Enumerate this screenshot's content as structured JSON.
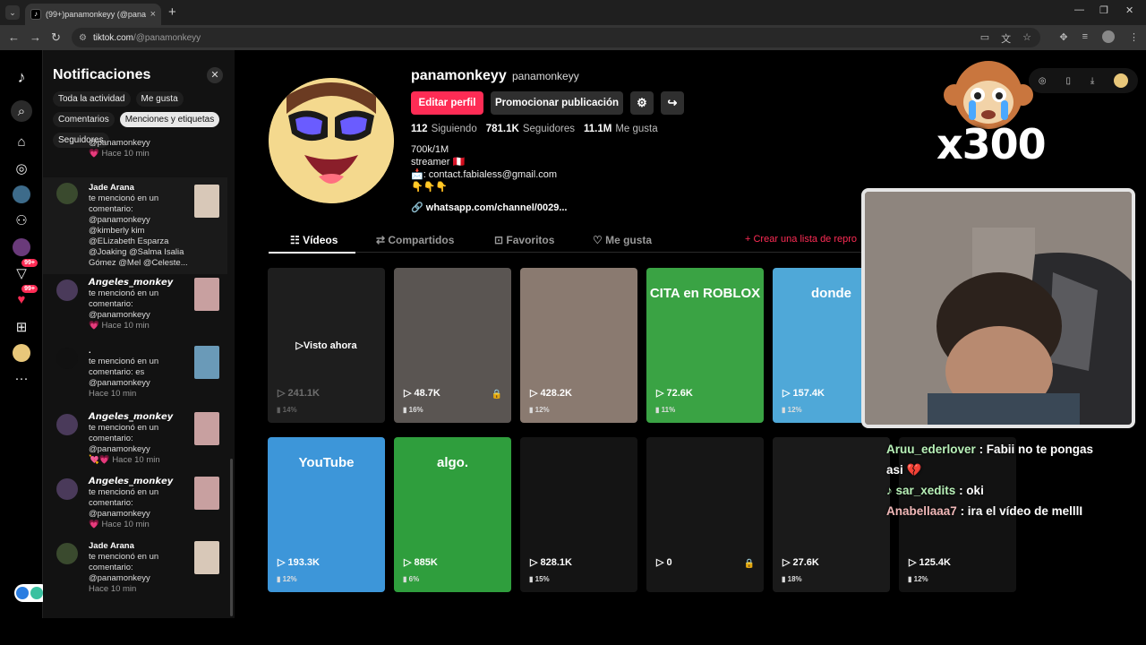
{
  "browser": {
    "tab_title": "(99+)panamonkeyy (@panamo…",
    "url_host": "tiktok.com",
    "url_path": "/@panamonkeyy"
  },
  "rail": {
    "badge_1": "99+",
    "badge_2": "99+"
  },
  "notifications": {
    "title": "Notificaciones",
    "filters": [
      {
        "label": "Toda la actividad",
        "active": false
      },
      {
        "label": "Me gusta",
        "active": false
      },
      {
        "label": "Comentarios",
        "active": false
      },
      {
        "label": "Menciones y etiquetas",
        "active": true
      },
      {
        "label": "Seguidores",
        "active": false
      }
    ],
    "items": [
      {
        "name": "",
        "lines": [
          "@panamonkeyy"
        ],
        "heart": "💗",
        "time": "Hace 10 min"
      },
      {
        "name": "Jade Arana",
        "lines": [
          "te mencionó en un",
          "comentario:",
          "@panamonkeyy",
          "@kimberly kim",
          "@ELizabeth Esparza",
          "@Joaking @Salma Isalia",
          "Gómez @Mel @Celeste..."
        ],
        "heart": "",
        "time": ""
      },
      {
        "name": "𝘼𝙣𝙜𝙚𝙡𝙚𝙨_𝙢𝙤𝙣𝙠𝙚𝙮",
        "lines": [
          "te mencionó en un",
          "comentario:",
          "@panamonkeyy"
        ],
        "heart": "💗",
        "time": "Hace 10 min"
      },
      {
        "name": ".",
        "lines": [
          "te mencionó en un",
          "comentario: es",
          "@panamonkeyy"
        ],
        "heart": "",
        "time": "Hace 10 min"
      },
      {
        "name": "𝘼𝙣𝙜𝙚𝙡𝙚𝙨_𝙢𝙤𝙣𝙠𝙚𝙮",
        "lines": [
          "te mencionó en un",
          "comentario:",
          "@panamonkeyy"
        ],
        "heart": "💘💗",
        "time": "Hace 10 min"
      },
      {
        "name": "𝘼𝙣𝙜𝙚𝙡𝙚𝙨_𝙢𝙤𝙣𝙠𝙚𝙮",
        "lines": [
          "te mencionó en un",
          "comentario:",
          "@panamonkeyy"
        ],
        "heart": "💗",
        "time": "Hace 10 min"
      },
      {
        "name": "Jade Arana",
        "lines": [
          "te mencionó en un",
          "comentario:",
          "@panamonkeyy"
        ],
        "heart": "",
        "time": "Hace 10 min"
      }
    ]
  },
  "profile": {
    "username": "panamonkeyy",
    "nickname": "panamonkeyy",
    "edit_button": "Editar perfil",
    "promote_button": "Promocionar publicación",
    "stats": [
      {
        "num": "112",
        "label": "Siguiendo"
      },
      {
        "num": "781.1K",
        "label": "Seguidores"
      },
      {
        "num": "11.1M",
        "label": "Me gusta"
      }
    ],
    "bio_lines": [
      "700k/1M",
      "streamer 🇵🇪",
      "📩: contact.fabialess@gmail.com",
      "👇👇👇"
    ],
    "link": "whatsapp.com/channel/0029...",
    "tabs": [
      "Vídeos",
      "Compartidos",
      "Favoritos",
      "Me gusta"
    ],
    "create_list": "+ Crear una lista de repro",
    "videos": [
      {
        "views": "241.1K",
        "pct": "14%",
        "overlay": "Visto ahora",
        "caption": "",
        "bg": "#1e1e1e",
        "lock": false
      },
      {
        "views": "48.7K",
        "pct": "16%",
        "overlay": "",
        "caption": "",
        "bg": "#5a5552",
        "lock": true
      },
      {
        "views": "428.2K",
        "pct": "12%",
        "overlay": "",
        "caption": "",
        "bg": "#8a7a70",
        "lock": false
      },
      {
        "views": "72.6K",
        "pct": "11%",
        "overlay": "",
        "caption": "CITA en ROBLOX",
        "bg": "#3aa344",
        "lock": false
      },
      {
        "views": "157.4K",
        "pct": "12%",
        "overlay": "",
        "caption": "donde",
        "bg": "#4fa8d8",
        "lock": false
      },
      {
        "views": "193.3K",
        "pct": "12%",
        "overlay": "",
        "caption": "YouTube",
        "bg": "#3d96d9",
        "lock": false
      },
      {
        "views": "885K",
        "pct": "6%",
        "overlay": "",
        "caption": "algo.",
        "bg": "#2f9e3d",
        "lock": false
      },
      {
        "views": "828.1K",
        "pct": "15%",
        "overlay": "",
        "caption": "",
        "bg": "#141414",
        "lock": false
      },
      {
        "views": "0",
        "pct": "",
        "overlay": "",
        "caption": "",
        "bg": "#161616",
        "lock": true
      },
      {
        "views": "27.6K",
        "pct": "18%",
        "overlay": "",
        "caption": "",
        "bg": "#1a1a1a",
        "lock": false
      },
      {
        "views": "125.4K",
        "pct": "12%",
        "overlay": "",
        "caption": "",
        "bg": "#121212",
        "lock": false
      }
    ]
  },
  "stream": {
    "counter": "x300",
    "chat": [
      {
        "user": "Aruu_ederlover",
        "msg": ": Fabii no te pongas asi 💔",
        "style": "green"
      },
      {
        "user": "♪ sar_xedits",
        "msg": ": oki",
        "style": "green"
      },
      {
        "user": "Anabellaaa7",
        "msg": ": ira el vídeo de melllI",
        "style": "pink"
      }
    ]
  }
}
